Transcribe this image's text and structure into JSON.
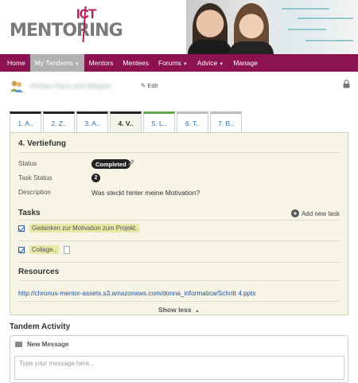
{
  "brand": {
    "logo_text": "MENTORING",
    "logo_suffix": "ICT"
  },
  "nav": {
    "items": [
      {
        "label": "Home"
      },
      {
        "label": "My Tandems",
        "dropdown": true,
        "active": true
      },
      {
        "label": "Mentors"
      },
      {
        "label": "Mentees"
      },
      {
        "label": "Forums",
        "dropdown": true
      },
      {
        "label": "Advice",
        "dropdown": true
      },
      {
        "label": "Manage"
      }
    ]
  },
  "group": {
    "name": "Pichau-Hans and Wegner",
    "edit_label": "Edit"
  },
  "tabs": [
    {
      "label": "1. A.."
    },
    {
      "label": "2. Z.."
    },
    {
      "label": "3. A.."
    },
    {
      "label": "4. V.."
    },
    {
      "label": "5. L.."
    },
    {
      "label": "6. T.."
    },
    {
      "label": "7. B.."
    }
  ],
  "step": {
    "title": "4. Vertiefung",
    "status_label": "Status",
    "status_value": "Completed",
    "task_status_label": "Task Status",
    "task_status_count": "2",
    "description_label": "Description",
    "description": "Was steckt hinter meine Motivation?",
    "tasks_heading": "Tasks",
    "add_task_label": "Add new task",
    "tasks": [
      {
        "text": "Gedanken zur Motivation zum Projekt."
      },
      {
        "text": "Collage.."
      }
    ],
    "resources_heading": "Resources",
    "resource_link": "http://chronus-mentor-assets.s3.amazonaws.com/donna_informatica/Schritt 4.pptx",
    "show_less_label": "Show less"
  },
  "activity": {
    "title": "Tandem Activity",
    "new_message_label": "New Message",
    "message_placeholder": "Type your message here..."
  },
  "colors": {
    "nav": "#8c1250",
    "panel": "#f5f4e5",
    "accent": "#b01c5c",
    "link": "#1f4f9a"
  }
}
